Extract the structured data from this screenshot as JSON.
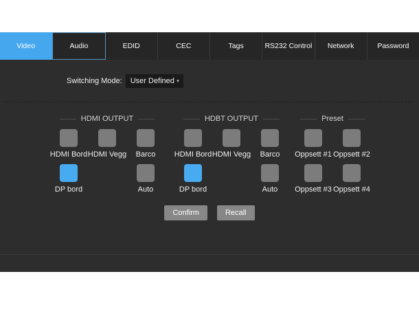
{
  "tabs": [
    {
      "label": "Video",
      "active": true,
      "focused": false
    },
    {
      "label": "Audio",
      "active": false,
      "focused": true
    },
    {
      "label": "EDID",
      "active": false,
      "focused": false
    },
    {
      "label": "CEC",
      "active": false,
      "focused": false
    },
    {
      "label": "Tags",
      "active": false,
      "focused": false
    },
    {
      "label": "RS232 Control",
      "active": false,
      "focused": false
    },
    {
      "label": "Network",
      "active": false,
      "focused": false
    },
    {
      "label": "Password",
      "active": false,
      "focused": false
    }
  ],
  "switching_mode": {
    "label": "Switching Mode:",
    "value": "User Defined",
    "caret_icon": "▾"
  },
  "groups": [
    {
      "title": "HDMI OUTPUT",
      "columns": 3,
      "rows": [
        [
          {
            "label": "HDMI Bord",
            "selected": false
          },
          {
            "label": "HDMI Vegg",
            "selected": false
          },
          {
            "label": "Barco",
            "selected": false
          }
        ],
        [
          {
            "label": "DP bord",
            "selected": true
          },
          null,
          {
            "label": "Auto",
            "selected": false
          }
        ]
      ]
    },
    {
      "title": "HDBT OUTPUT",
      "columns": 3,
      "rows": [
        [
          {
            "label": "HDMI Bord",
            "selected": false
          },
          {
            "label": "HDMI Vegg",
            "selected": false
          },
          {
            "label": "Barco",
            "selected": false
          }
        ],
        [
          {
            "label": "DP bord",
            "selected": true
          },
          null,
          {
            "label": "Auto",
            "selected": false
          }
        ]
      ]
    },
    {
      "title": "Preset",
      "columns": 2,
      "rows": [
        [
          {
            "label": "Oppsett #1",
            "selected": false
          },
          {
            "label": "Oppsett #2",
            "selected": false
          }
        ],
        [
          {
            "label": "Oppsett #3",
            "selected": false
          },
          {
            "label": "Oppsett #4",
            "selected": false
          }
        ]
      ]
    }
  ],
  "actions": {
    "confirm": "Confirm",
    "recall": "Recall"
  },
  "colors": {
    "accent_blue": "#45a8ee",
    "panel_bg": "#2d2d2d",
    "tabbar_bg": "#262626",
    "button_gray": "#7c7c7c",
    "selected_blue": "#48abf0"
  }
}
